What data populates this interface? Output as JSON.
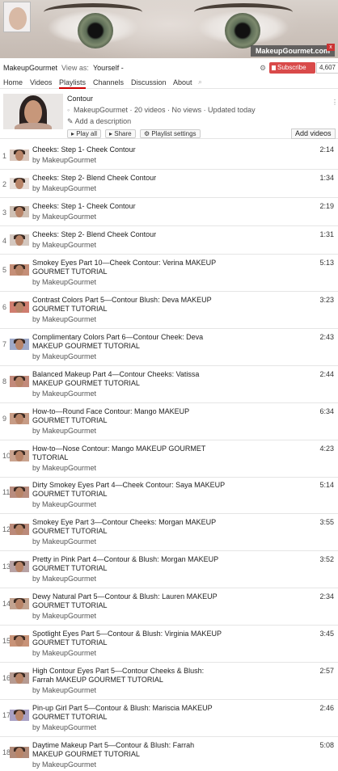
{
  "banner": {
    "brand": "MakeupGourmet.com",
    "close": "x"
  },
  "channel": {
    "name": "MakeupGourmet",
    "view_as_label": "View as:",
    "view_as_value": "Yourself -",
    "subscribe_label": "Subscribe",
    "subscriber_count": "4,607"
  },
  "tabs": [
    "Home",
    "Videos",
    "Playlists",
    "Channels",
    "Discussion",
    "About"
  ],
  "active_tab": "Playlists",
  "playlist": {
    "title": "Contour",
    "meta": "MakeupGourmet · 20 videos · No views · Updated today",
    "add_description": "Add a description",
    "play_all": "Play all",
    "share": "Share",
    "settings": "Playlist settings",
    "add_videos": "Add videos"
  },
  "videos": [
    {
      "index": "1",
      "title": "Cheeks: Step 1- Cheek Contour",
      "by": "by MakeupGourmet",
      "duration": "2:14"
    },
    {
      "index": "2",
      "title": "Cheeks: Step 2- Blend Cheek Contour",
      "by": "by MakeupGourmet",
      "duration": "1:34"
    },
    {
      "index": "3",
      "title": "Cheeks: Step 1- Cheek Contour",
      "by": "by MakeupGourmet",
      "duration": "2:19"
    },
    {
      "index": "4",
      "title": "Cheeks: Step 2- Blend Cheek Contour",
      "by": "by MakeupGourmet",
      "duration": "1:31"
    },
    {
      "index": "5",
      "title": "Smokey Eyes Part 10—Cheek Contour: Verina MAKEUP GOURMET TUTORIAL",
      "by": "by MakeupGourmet",
      "duration": "5:13"
    },
    {
      "index": "6",
      "title": "Contrast Colors Part 5—Contour Blush: Deva MAKEUP GOURMET TUTORIAL",
      "by": "by MakeupGourmet",
      "duration": "3:23"
    },
    {
      "index": "7",
      "title": "Complimentary Colors Part 6—Contour Cheek: Deva MAKEUP GOURMET TUTORIAL",
      "by": "by MakeupGourmet",
      "duration": "2:43"
    },
    {
      "index": "8",
      "title": "Balanced Makeup Part 4—Contour Cheeks: Vatissa MAKEUP GOURMET TUTORIAL",
      "by": "by MakeupGourmet",
      "duration": "2:44"
    },
    {
      "index": "9",
      "title": "How-to—Round Face Contour: Mango MAKEUP GOURMET TUTORIAL",
      "by": "by MakeupGourmet",
      "duration": "6:34"
    },
    {
      "index": "10",
      "title": "How-to—Nose Contour: Mango MAKEUP GOURMET TUTORIAL",
      "by": "by MakeupGourmet",
      "duration": "4:23"
    },
    {
      "index": "11",
      "title": "Dirty Smokey Eyes Part 4—Cheek Contour: Saya MAKEUP GOURMET TUTORIAL",
      "by": "by MakeupGourmet",
      "duration": "5:14"
    },
    {
      "index": "12",
      "title": "Smokey Eye Part 3—Contour Cheeks: Morgan MAKEUP GOURMET TUTORIAL",
      "by": "by MakeupGourmet",
      "duration": "3:55"
    },
    {
      "index": "13",
      "title": "Pretty in Pink Part 4—Contour & Blush: Morgan MAKEUP GOURMET TUTORIAL",
      "by": "by MakeupGourmet",
      "duration": "3:52"
    },
    {
      "index": "14",
      "title": "Dewy Natural Part 5—Contour & Blush: Lauren MAKEUP GOURMET TUTORIAL",
      "by": "by MakeupGourmet",
      "duration": "2:34"
    },
    {
      "index": "15",
      "title": "Spotlight Eyes Part 5—Contour & Blush: Virginia MAKEUP GOURMET TUTORIAL",
      "by": "by MakeupGourmet",
      "duration": "3:45"
    },
    {
      "index": "16",
      "title": "High Contour Eyes Part 5—Contour Cheeks & Blush: Farrah MAKEUP GOURMET TUTORIAL",
      "by": "by MakeupGourmet",
      "duration": "2:57"
    },
    {
      "index": "17",
      "title": "Pin-up Girl Part 5—Contour & Blush: Mariscia MAKEUP GOURMET TUTORIAL",
      "by": "by MakeupGourmet",
      "duration": "2:46"
    },
    {
      "index": "18",
      "title": "Daytime Makeup Part 5—Contour & Blush: Farrah MAKEUP GOURMET TUTORIAL",
      "by": "by MakeupGourmet",
      "duration": "5:08"
    }
  ],
  "colors": {
    "subscribe": "#d94a4a",
    "active_tab": "#cc0000"
  }
}
